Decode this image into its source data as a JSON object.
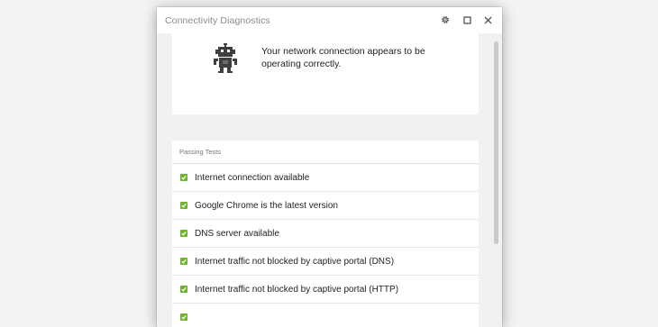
{
  "window": {
    "title": "Connectivity Diagnostics",
    "buttons": {
      "settings": "gear-icon",
      "maximize": "maximize-icon",
      "close": "close-icon"
    }
  },
  "status": {
    "icon": "robot-icon",
    "message": "Your network connection appears to be operating correctly."
  },
  "tests": {
    "header": "Passing Tests",
    "check_color": "#6fb32f",
    "items": [
      {
        "label": "Internet connection available"
      },
      {
        "label": "Google Chrome is the latest version"
      },
      {
        "label": "DNS server available"
      },
      {
        "label": "Internet traffic not blocked by captive portal (DNS)"
      },
      {
        "label": "Internet traffic not blocked by captive portal (HTTP)"
      }
    ]
  }
}
